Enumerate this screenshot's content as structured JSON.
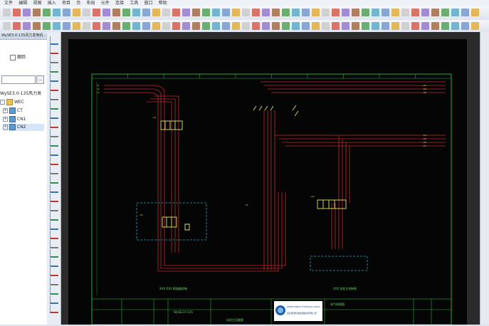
{
  "menu": [
    "文件",
    "编辑",
    "视图",
    "插入",
    "项目",
    "页",
    "布局",
    "元件",
    "连接",
    "工具",
    "窗口",
    "帮助"
  ],
  "panel": {
    "title": "WySE3.0-135风力发电机 - x",
    "checkbox_label": "跟踪",
    "filter_button": "...",
    "tree": [
      {
        "label": "WySE3.0-135风力发",
        "expander": "-"
      },
      {
        "label": "WEC",
        "expander": "-"
      },
      {
        "label": "CT",
        "expander": "+"
      },
      {
        "label": "CN1",
        "expander": "+"
      },
      {
        "label": "CN2",
        "expander": "+"
      }
    ]
  },
  "drawing": {
    "left_block_label": "XXX.XXX 断路器控制",
    "right_block_label": "XXX 风机主控制柜",
    "title_block": {
      "project_no": "WySE3.0-135",
      "drawing_title": "风机主回路图",
      "company_en": "WINDEY ENERGY TECHNOLOGY GROUP",
      "company_cn": "运达能源科技集团股份有限公司",
      "sheet_title": "电气原理图"
    }
  },
  "colors": {
    "sheet_bg": "#050505",
    "border": "#1fae3a",
    "wire": "#c0282c",
    "device": "#e6e35a",
    "dashed": "#2aa8c4",
    "text": "#6ed36e"
  }
}
